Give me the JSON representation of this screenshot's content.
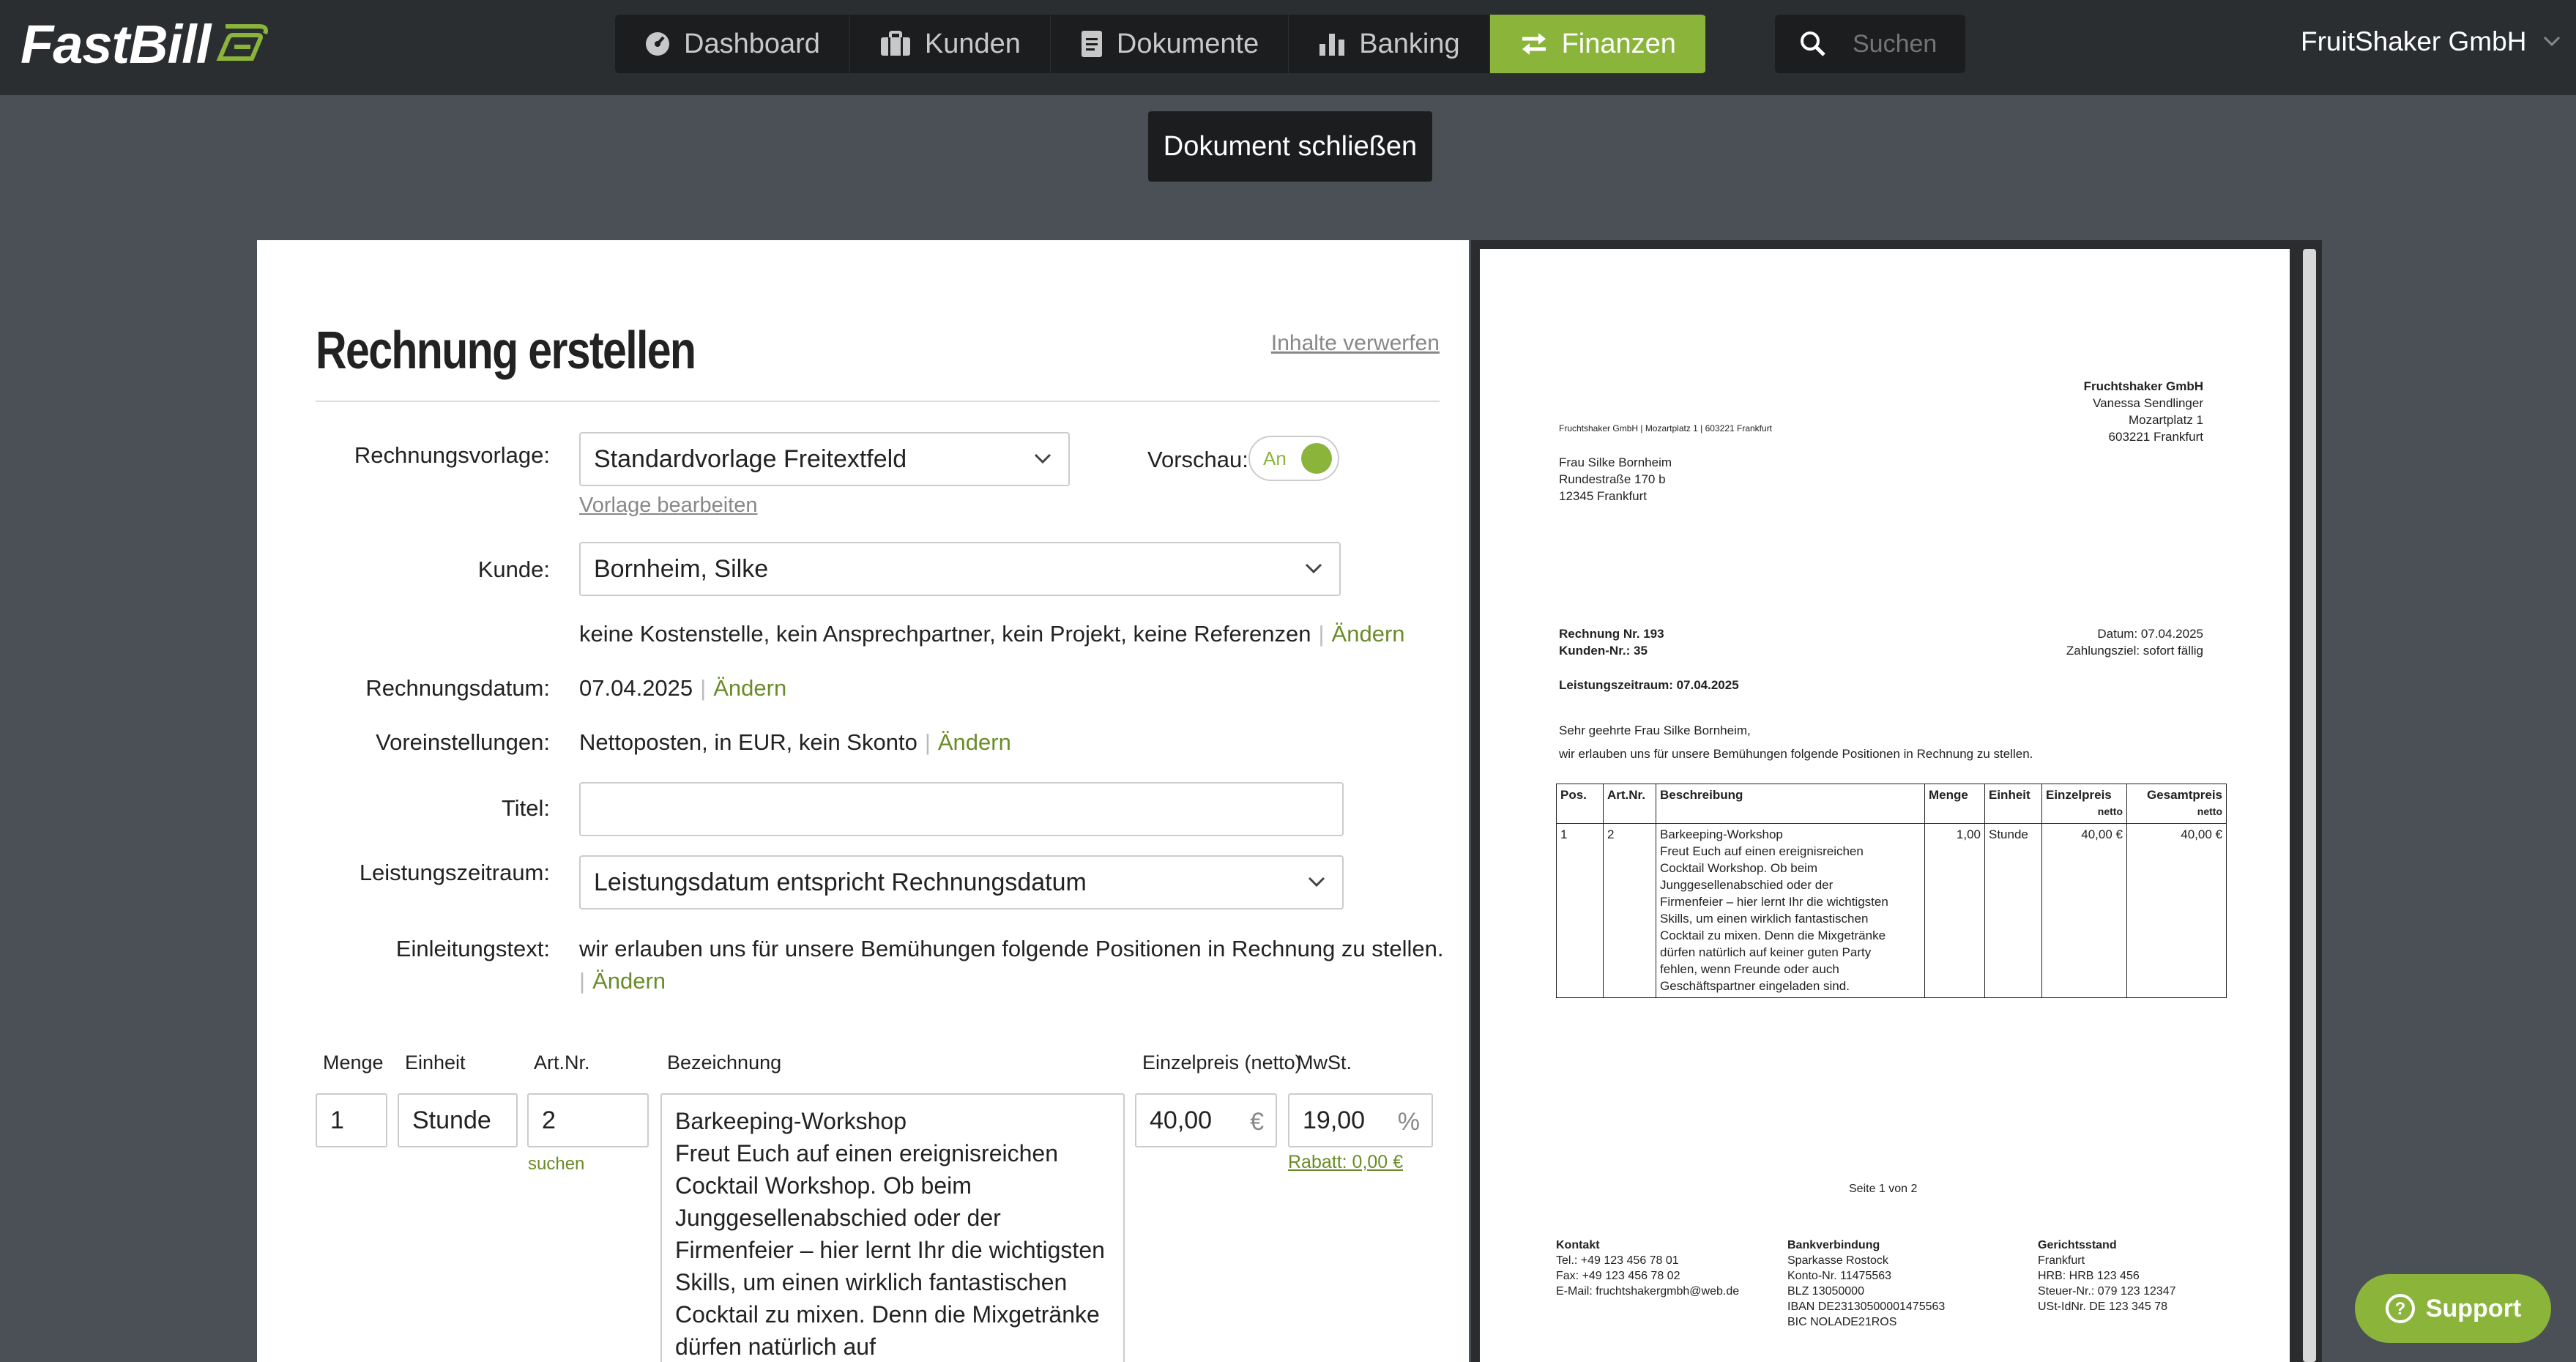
{
  "app": {
    "logo": "FastBill",
    "company": "FruitShaker GmbH"
  },
  "nav": {
    "items": [
      {
        "label": "Dashboard",
        "icon": "dashboard-icon"
      },
      {
        "label": "Kunden",
        "icon": "briefcase-icon"
      },
      {
        "label": "Dokumente",
        "icon": "document-icon"
      },
      {
        "label": "Banking",
        "icon": "bar-chart-icon"
      },
      {
        "label": "Finanzen",
        "icon": "exchange-icon",
        "active": true
      }
    ],
    "search_placeholder": "Suchen"
  },
  "close_doc_label": "Dokument schließen",
  "form": {
    "title": "Rechnung erstellen",
    "discard": "Inhalte verwerfen",
    "labels": {
      "vorlage": "Rechnungsvorlage:",
      "kunde": "Kunde:",
      "datum": "Rechnungsdatum:",
      "voreinst": "Voreinstellungen:",
      "titel": "Titel:",
      "zeitraum": "Leistungszeitraum:",
      "einleitung": "Einleitungstext:",
      "vorschau": "Vorschau:"
    },
    "vorlage_value": "Standardvorlage Freitextfeld",
    "vorlage_edit": "Vorlage bearbeiten",
    "toggle_label": "An",
    "kunde_value": "Bornheim, Silke",
    "kunde_details": "keine Kostenstelle, kein Ansprechpartner, kein Projekt, keine Referenzen",
    "aendern": "Ändern",
    "datum_value": "07.04.2025",
    "voreinst_value": "Nettoposten, in EUR, kein Skonto",
    "titel_value": "",
    "zeitraum_value": "Leistungsdatum entspricht Rechnungsdatum",
    "einleitung_value": "wir erlauben uns für unsere Bemühungen folgende Positionen in Rechnung zu stellen.",
    "columns": {
      "menge": "Menge",
      "einheit": "Einheit",
      "artnr": "Art.Nr.",
      "bez": "Bezeichnung",
      "einzelpreis": "Einzelpreis (netto)",
      "mwst": "MwSt."
    },
    "item": {
      "menge": "1",
      "einheit": "Stunde",
      "artnr": "2",
      "bez_title": "Barkeeping-Workshop",
      "bez_text": "Freut Euch auf einen ereignisreichen Cocktail Workshop. Ob beim Junggesellenabschied oder der Firmenfeier – hier lernt Ihr die wichtigsten Skills, um einen wirklich fantastischen Cocktail zu mixen. Denn die Mixgetränke dürfen natürlich auf",
      "einzelpreis": "40,00",
      "currency": "€",
      "mwst": "19,00",
      "percent": "%",
      "suchen": "suchen",
      "rabatt": "Rabatt: 0,00 €"
    }
  },
  "preview": {
    "sender_name": "Fruchtshaker GmbH",
    "sender_lines": [
      "Vanessa Sendlinger",
      "Mozartplatz 1",
      "603221 Frankfurt"
    ],
    "sender_small": "Fruchtshaker GmbH | Mozartplatz 1 | 603221 Frankfurt",
    "recipient": [
      "Frau Silke Bornheim",
      "Rundestraße 170 b",
      "12345 Frankfurt"
    ],
    "rechnung_nr": "Rechnung Nr. 193",
    "kunden_nr": "Kunden-Nr.: 35",
    "datum": "Datum: 07.04.2025",
    "zahlungsziel": "Zahlungsziel: sofort fällig",
    "leistungszeitraum": "Leistungszeitraum: 07.04.2025",
    "greeting": "Sehr geehrte Frau Silke Bornheim,",
    "intro": "wir erlauben uns für unsere Bemühungen folgende Positionen in Rechnung zu stellen.",
    "table": {
      "headers": [
        "Pos.",
        "Art.Nr.",
        "Beschreibung",
        "Menge",
        "Einheit",
        "Einzelpreis",
        "Gesamtpreis"
      ],
      "netto": "netto",
      "row": {
        "pos": "1",
        "artnr": "2",
        "title": "Barkeeping-Workshop",
        "desc_lines": [
          "Freut Euch auf einen ereignisreichen",
          "Cocktail Workshop. Ob beim",
          "Junggesellenabschied oder der",
          "Firmenfeier – hier lernt Ihr die wichtigsten",
          "Skills, um einen wirklich fantastischen",
          "Cocktail zu mixen. Denn die Mixgetränke",
          "dürfen natürlich auf keiner guten Party",
          "fehlen, wenn Freunde oder auch",
          "Geschäftspartner eingeladen sind."
        ],
        "menge": "1,00",
        "einheit": "Stunde",
        "einzelpreis": "40,00 €",
        "gesamtpreis": "40,00 €"
      }
    },
    "page_indicator": "Seite   1 von   2",
    "footer": {
      "kontakt": {
        "title": "Kontakt",
        "lines": [
          "Tel.: +49 123 456 78 01",
          "Fax: +49 123 456 78 02",
          "E-Mail: fruchtshakergmbh@web.de"
        ]
      },
      "bank": {
        "title": "Bankverbindung",
        "lines": [
          "Sparkasse Rostock",
          "Konto-Nr. 11475563",
          "BLZ 13050000",
          "IBAN DE23130500001475563",
          "BIC NOLADE21ROS"
        ]
      },
      "gericht": {
        "title": "Gerichtsstand",
        "lines": [
          "Frankfurt",
          "HRB: HRB 123 456",
          "Steuer-Nr.: 079 123 12347",
          "USt-IdNr. DE 123 345 78"
        ]
      }
    }
  },
  "support_label": "Support",
  "colors": {
    "accent": "#8ab43a",
    "topbar": "#2b2e31",
    "background": "#4a5055"
  }
}
